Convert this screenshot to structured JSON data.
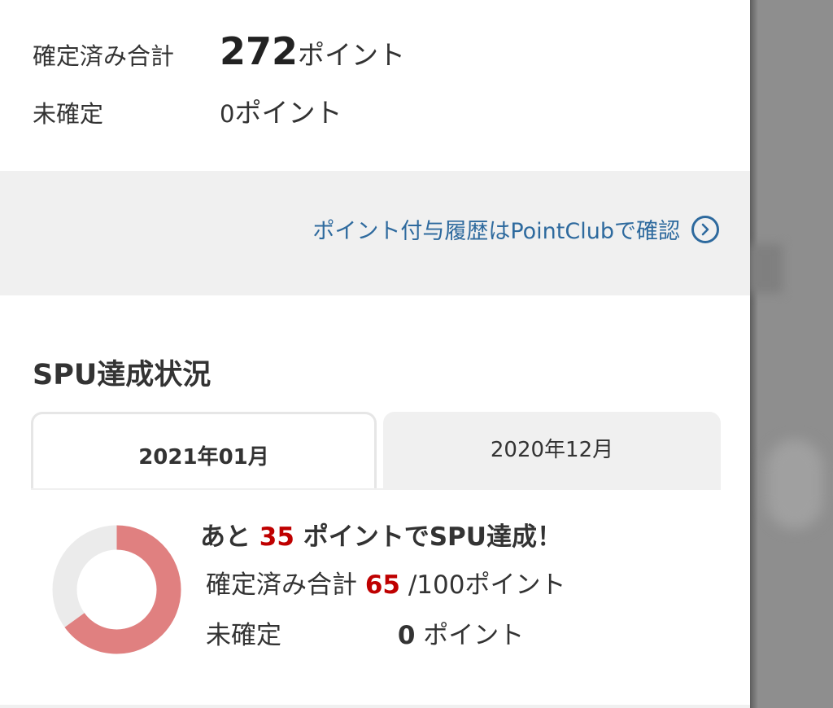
{
  "summary": {
    "confirmed_label": "確定済み合計",
    "confirmed_value": "272",
    "confirmed_unit": "ポイント",
    "unconfirmed_label": "未確定",
    "unconfirmed_value": "0",
    "unconfirmed_unit": "ポイント"
  },
  "history_link": {
    "label": "ポイント付与履歴はPointClubで確認",
    "icon": "chevron-right-circle-icon",
    "color": "#2e6a9e"
  },
  "spu": {
    "title": "SPU達成状況",
    "tabs": [
      {
        "label": "2021年01月",
        "active": true
      },
      {
        "label": "2020年12月",
        "active": false
      }
    ],
    "remaining_prefix": "あと",
    "remaining_value": "35",
    "remaining_suffix": "ポイントでSPU達成！",
    "confirmed_label": "確定済み合計",
    "confirmed_value": "65",
    "confirmed_total": "/100ポイント",
    "unconfirmed_label": "未確定",
    "unconfirmed_value": "0",
    "unconfirmed_unit": "ポイント",
    "progress": 0.65,
    "progress_color": "#e08080",
    "track_color": "#ebebeb",
    "highlight_color": "#bf0000"
  }
}
